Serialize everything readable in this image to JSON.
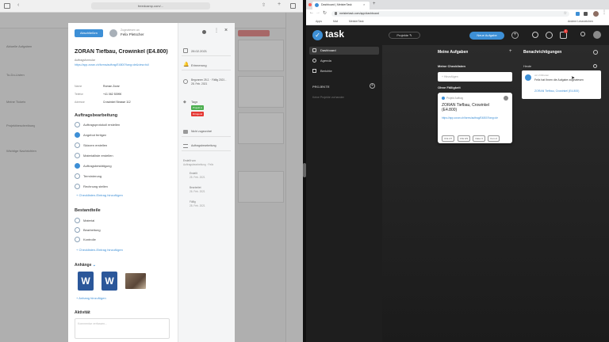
{
  "left_browser": {
    "address": "freedcamp.com/...",
    "bg_rows": [
      "Aktuelle Aufgaben",
      "To-Do-Listen",
      "Meine Tickets",
      "Projektbeschreibung",
      "Wichtige Nachrichten"
    ]
  },
  "task_panel": {
    "mark_complete": "Abschließen",
    "assignee_label": "Zugewiesen an",
    "assignee_name": "Felix Pletscher",
    "title": "ZORAN Tiefbau, Crowinkel (E4.800)",
    "link_label": "Auftragsformular",
    "link": "https://app.zoran.ch/forms/auftrag/E4800?lang=de&view=full",
    "info": [
      {
        "label": "Name",
        "value": "Roman Zoran"
      },
      {
        "label": "Telefon",
        "value": "+41 062 53996"
      },
      {
        "label": "Adresse",
        "value": "Crowinkel Strasse 112"
      }
    ],
    "section1_title": "Auftragsbearbeitung",
    "checklist1": [
      {
        "label": "Auftragsprotokoll erstellen",
        "done": false
      },
      {
        "label": "Angebot fertigen",
        "done": true
      },
      {
        "label": "Skizzen erstellen",
        "done": false
      },
      {
        "label": "Materialliste erstellen",
        "done": false
      },
      {
        "label": "Auftragsbestätigung",
        "done": true
      },
      {
        "label": "Terminierung",
        "done": false
      },
      {
        "label": "Rechnung stellen",
        "done": false
      }
    ],
    "add_item1": "Checklisten-Eintrag hinzufügen",
    "section2_title": "Bestandteile",
    "checklist2": [
      {
        "label": "Material",
        "done": false
      },
      {
        "label": "Bearbeitung",
        "done": false
      },
      {
        "label": "Kontrolle",
        "done": false
      }
    ],
    "add_item2": "Checklisten-Eintrag hinzufügen",
    "attachments_title": "Anhänge",
    "add_attachment": "Anhang hinzufügen",
    "activity_title": "Aktivität",
    "comment_placeholder": "Kommentar verfassen..."
  },
  "task_side": {
    "due_date": "28.02.2021",
    "reminder": "Erinnerung",
    "date_range": "Begonnen 25.2. · Fällig 2021 - 28. Feb. 2021",
    "tags_label": "Tags",
    "tags": [
      {
        "label": "Projekt A",
        "color": "#4caf50"
      },
      {
        "label": "Dringend",
        "color": "#e53935"
      }
    ],
    "project_label": "Nicht zugeordnet",
    "status_label": "Auftragsbearbeitung",
    "log": [
      {
        "title": "Erstellt von",
        "detail": "Auftragsbearbeitung · Felix"
      },
      {
        "title": "Erstellt",
        "detail": "25. Feb. 2021"
      },
      {
        "title": "Bearbeitet",
        "detail": "26. Feb. 2021"
      },
      {
        "title": "Fällig",
        "detail": "28. Feb. 2021"
      }
    ]
  },
  "right_browser": {
    "tab_title": "Dashboard | MeisterTask",
    "url": "meistertask.com/app/dashboard",
    "bookmarks": [
      "Apps",
      "Mail",
      "MeisterTask"
    ],
    "more_bookmarks": "Andere Lesezeichen"
  },
  "meistertask": {
    "logo": "task",
    "project_button": "Projekte",
    "new_task_button": "Neue Aufgabe",
    "notification_count": "1",
    "nav": [
      "Dashboard",
      "Agenda",
      "Berichte"
    ],
    "projects_label": "PROJEKTE",
    "no_projects": "Keine Projekte vorhanden",
    "col1_title": "Meine Aufgaben",
    "checklists_label": "Meine Checklisten",
    "add_checklist": "Hinzufügen",
    "overdue_label": "Ohne Fälligkeit",
    "card_project": "Projekt Auftrag",
    "card_title": "ZORAN Tiefbau, Crowinkel (E4.800)",
    "card_link": "https://app.zoran.ch/forms/auftrag/E4800?lang=de",
    "card_chips": [
      "Chk 2/7",
      "Chk 0/3",
      "Datei 3",
      "Kom 0"
    ],
    "col2_title": "Benachrichtigungen",
    "notif_section": "Heute",
    "notif_time": "vor 2 Minuten",
    "notif_text": "Felix hat Ihnen die Aufgabe zugewiesen",
    "notif_task": "ZORAN Tiefbau, Crowinkel (E4.800)"
  },
  "colors": {
    "accent": "#3d8fd6",
    "dark_bg": "#262626",
    "tag_green": "#4caf50",
    "tag_red": "#e53935",
    "word_blue": "#2b579a"
  }
}
